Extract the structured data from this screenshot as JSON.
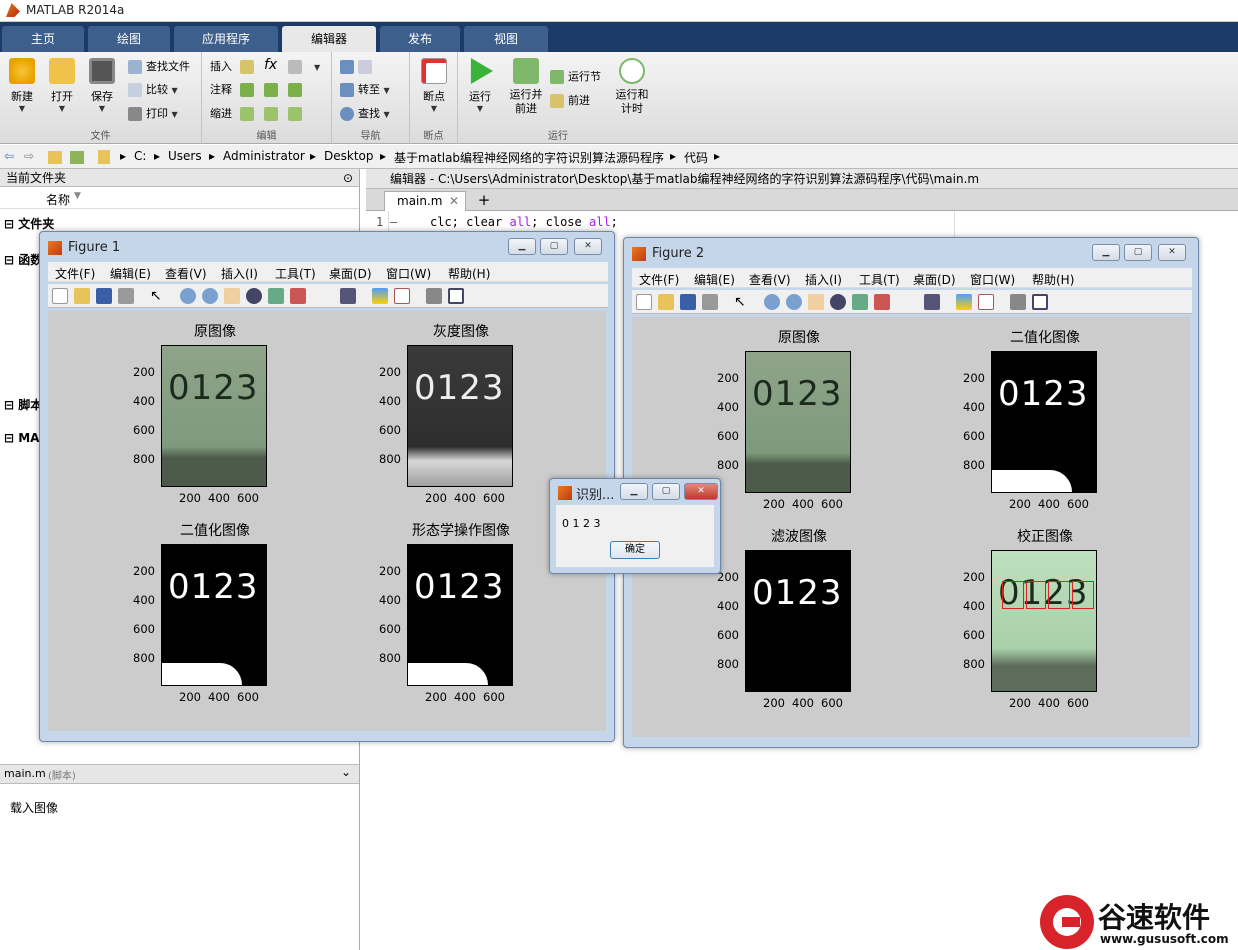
{
  "app": {
    "title": "MATLAB R2014a"
  },
  "tabs": [
    {
      "label": "主页"
    },
    {
      "label": "绘图"
    },
    {
      "label": "应用程序"
    },
    {
      "label": "编辑器"
    },
    {
      "label": "发布"
    },
    {
      "label": "视图"
    }
  ],
  "ribbon": {
    "file": {
      "section": "文件",
      "new": "新建",
      "open": "打开",
      "save": "保存",
      "find_files": "查找文件",
      "compare": "比较",
      "print": "打印"
    },
    "edit": {
      "section": "编辑",
      "insert": "插入",
      "comment": "注释",
      "indent": "缩进",
      "fx": "fx"
    },
    "navigate": {
      "section": "导航",
      "goto": "转至",
      "find": "查找"
    },
    "breakpoints": {
      "section": "断点",
      "breakpoints": "断点"
    },
    "run": {
      "section": "运行",
      "run": "运行",
      "run_advance": "运行并\n前进",
      "run_section": "运行节",
      "advance": "前进",
      "run_time": "运行和\n计时"
    }
  },
  "address": {
    "crumbs": [
      "C:",
      "Users",
      "Administrator",
      "Desktop",
      "基于matlab编程神经网络的字符识别算法源码程序",
      "代码"
    ]
  },
  "left_panel": {
    "header": "当前文件夹",
    "col_name": "名称",
    "folders": [
      "文件夹",
      "函数",
      "脚本",
      "MA"
    ],
    "detail_header": "main.m",
    "detail_sub": "(脚本)",
    "detail_text": "载入图像"
  },
  "editor": {
    "header": "编辑器 - C:\\Users\\Administrator\\Desktop\\基于matlab编程神经网络的字符识别算法源码程序\\代码\\main.m",
    "tab": "main.m",
    "plus": "+",
    "line_no": "1",
    "line_marker": "—",
    "code_kw1": "clc; clear ",
    "code_all1": "all",
    "code_kw2": "; close ",
    "code_all2": "all",
    "code_end": ";"
  },
  "figure_menu": [
    "文件(F)",
    "编辑(E)",
    "查看(V)",
    "插入(I)",
    "工具(T)",
    "桌面(D)",
    "窗口(W)",
    "帮助(H)"
  ],
  "figure1": {
    "title": "Figure 1",
    "plots": [
      {
        "title": "原图像",
        "digits": "0123"
      },
      {
        "title": "灰度图像",
        "digits": "0123"
      },
      {
        "title": "二值化图像",
        "digits": "0123"
      },
      {
        "title": "形态学操作图像",
        "digits": "0123"
      }
    ]
  },
  "figure2": {
    "title": "Figure 2",
    "plots": [
      {
        "title": "原图像",
        "digits": "0123"
      },
      {
        "title": "二值化图像",
        "digits": "0123"
      },
      {
        "title": "滤波图像",
        "digits": "0123"
      },
      {
        "title": "校正图像",
        "digits": "0123"
      }
    ]
  },
  "axis": {
    "yticks": [
      "200",
      "400",
      "600",
      "800"
    ],
    "xticks": [
      "200",
      "400",
      "600"
    ]
  },
  "dialog": {
    "title": "识别...",
    "message": "0 1 2 3",
    "ok": "确定"
  },
  "watermark": {
    "brand": "谷速软件",
    "url": "www.gususoft.com"
  },
  "colors": {
    "accent": "#1b3a66",
    "close_red": "#c0392b",
    "keyword_purple": "#a020f0"
  }
}
